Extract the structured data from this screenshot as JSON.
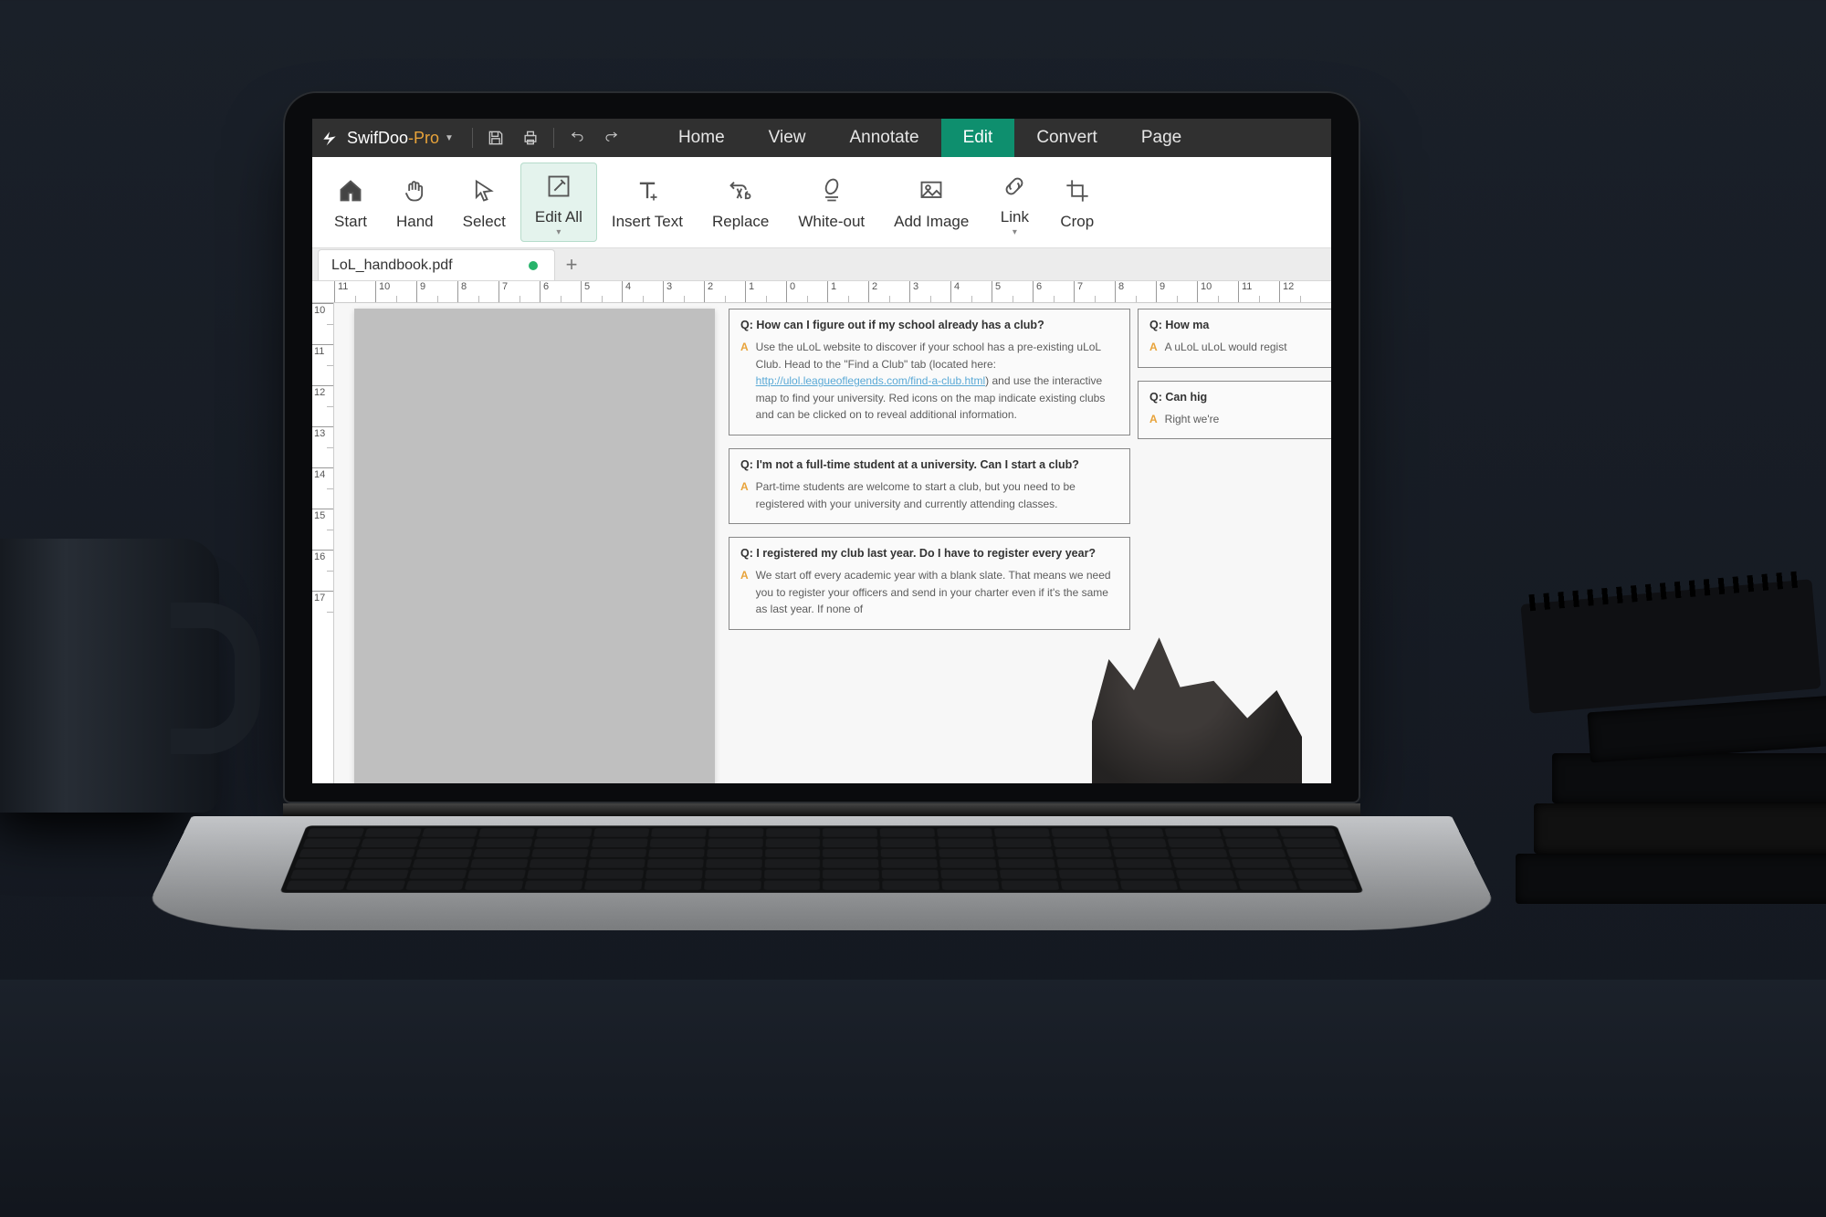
{
  "brand": {
    "a": "SwifDoo",
    "b": "-Pro"
  },
  "menus": [
    {
      "label": "Home",
      "active": false
    },
    {
      "label": "View",
      "active": false
    },
    {
      "label": "Annotate",
      "active": false
    },
    {
      "label": "Edit",
      "active": true
    },
    {
      "label": "Convert",
      "active": false
    },
    {
      "label": "Page",
      "active": false
    }
  ],
  "ribbon": [
    {
      "id": "start",
      "label": "Start",
      "selected": false,
      "dropdown": false
    },
    {
      "id": "hand",
      "label": "Hand",
      "selected": false,
      "dropdown": false
    },
    {
      "id": "select",
      "label": "Select",
      "selected": false,
      "dropdown": false
    },
    {
      "id": "edit-all",
      "label": "Edit All",
      "selected": true,
      "dropdown": true
    },
    {
      "id": "insert-text",
      "label": "Insert Text",
      "selected": false,
      "dropdown": false
    },
    {
      "id": "replace",
      "label": "Replace",
      "selected": false,
      "dropdown": false
    },
    {
      "id": "white-out",
      "label": "White-out",
      "selected": false,
      "dropdown": false
    },
    {
      "id": "add-image",
      "label": "Add Image",
      "selected": false,
      "dropdown": false
    },
    {
      "id": "link",
      "label": "Link",
      "selected": false,
      "dropdown": true
    },
    {
      "id": "crop",
      "label": "Crop",
      "selected": false,
      "dropdown": false
    }
  ],
  "tabs": {
    "open": [
      {
        "title": "LoL_handbook.pdf",
        "unsaved": true
      }
    ],
    "add_label": "+"
  },
  "ruler": {
    "horizontal": [
      "11",
      "10",
      "9",
      "8",
      "7",
      "6",
      "5",
      "4",
      "3",
      "2",
      "1",
      "0",
      "1",
      "2",
      "3",
      "4",
      "5",
      "6",
      "7",
      "8",
      "9",
      "10",
      "11",
      "12"
    ],
    "vertical": [
      "10",
      "11",
      "12",
      "13",
      "14",
      "15",
      "16",
      "17"
    ]
  },
  "document": {
    "col1": [
      {
        "question": "How can I figure out if my school already has a club?",
        "answer_prefix": "Use the uLoL website to discover if your school has a pre-existing uLoL Club. Head to the \"Find a Club\" tab (located here: ",
        "link_text": "http://ulol.leagueoflegends.com/find-a-club.html",
        "answer_suffix": ") and use the interactive map to find your university. Red icons on the map indicate existing clubs and can be clicked on to reveal additional information."
      },
      {
        "question": "I'm not a full-time student at a university. Can I start a club?",
        "answer": "Part-time students are welcome to start a club, but you need to be registered with your university and currently attending classes."
      },
      {
        "question": "I registered my club last year. Do I have to register every year?",
        "answer": "We start off every academic year with a blank slate. That means we need you to register your officers and send in your charter even if it's the same as last year. If none of"
      }
    ],
    "col2": [
      {
        "question": "How ma",
        "answer": "A uLoL uLoL would regist"
      },
      {
        "question": "Can hig",
        "answer": "Right we're"
      }
    ]
  },
  "colors": {
    "accent": "#0e8f6e",
    "brand_orange": "#e8a33a",
    "link": "#5aa9d6"
  }
}
